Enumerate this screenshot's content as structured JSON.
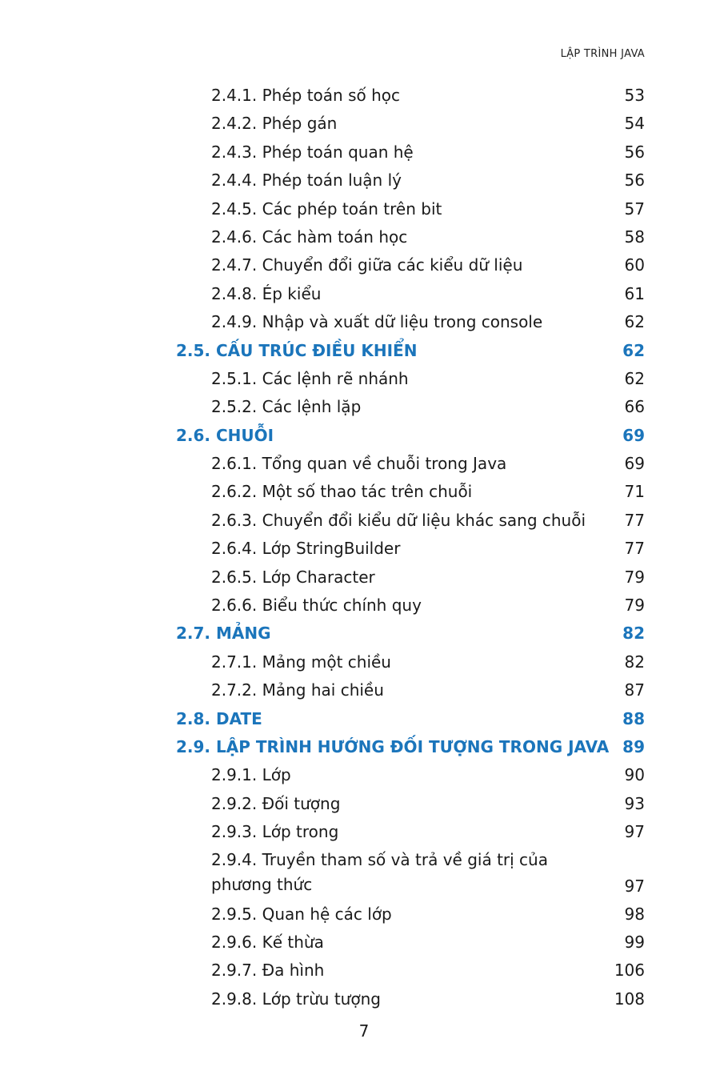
{
  "header": {
    "running_title": "LẬP TRÌNH JAVA"
  },
  "toc": [
    {
      "num": "2.4.1.",
      "title": "Phép toán số học",
      "page": "53"
    },
    {
      "num": "2.4.2.",
      "title": "Phép gán",
      "page": "54"
    },
    {
      "num": "2.4.3.",
      "title": "Phép toán quan hệ",
      "page": "56"
    },
    {
      "num": "2.4.4.",
      "title": "Phép toán luận lý",
      "page": "56"
    },
    {
      "num": "2.4.5.",
      "title": "Các phép toán trên bit",
      "page": "57"
    },
    {
      "num": "2.4.6.",
      "title": "Các hàm toán học",
      "page": "58"
    },
    {
      "num": "2.4.7.",
      "title": "Chuyển đổi giữa các kiểu dữ liệu",
      "page": "60"
    },
    {
      "num": "2.4.8.",
      "title": "Ép kiểu",
      "page": "61"
    },
    {
      "num": "2.4.9.",
      "title": "Nhập và xuất dữ liệu trong console",
      "page": "62"
    },
    {
      "num": "2.5.",
      "title": "CẤU TRÚC ĐIỀU KHIỂN",
      "page": "62"
    },
    {
      "num": "2.5.1.",
      "title": "Các lệnh rẽ nhánh",
      "page": "62"
    },
    {
      "num": "2.5.2.",
      "title": "Các lệnh lặp",
      "page": "66"
    },
    {
      "num": "2.6.",
      "title": "CHUỖI",
      "page": "69"
    },
    {
      "num": "2.6.1.",
      "title": "Tổng quan về chuỗi trong Java",
      "page": "69"
    },
    {
      "num": "2.6.2.",
      "title": "Một số thao tác trên chuỗi",
      "page": "71"
    },
    {
      "num": "2.6.3.",
      "title": "Chuyển đổi kiểu dữ liệu khác sang chuỗi",
      "page": "77"
    },
    {
      "num": "2.6.4.",
      "title": "Lớp StringBuilder",
      "page": "77"
    },
    {
      "num": "2.6.5.",
      "title": "Lớp Character",
      "page": "79"
    },
    {
      "num": "2.6.6.",
      "title": "Biểu thức chính quy",
      "page": "79"
    },
    {
      "num": "2.7.",
      "title": "MẢNG",
      "page": "82"
    },
    {
      "num": "2.7.1.",
      "title": "Mảng một chiều",
      "page": "82"
    },
    {
      "num": "2.7.2.",
      "title": "Mảng hai chiều",
      "page": "87"
    },
    {
      "num": "2.8.",
      "title": "DATE",
      "page": "88"
    },
    {
      "num": "2.9.",
      "title": "LẬP TRÌNH HƯỚNG ĐỐI TƯỢNG TRONG JAVA",
      "page": "89"
    },
    {
      "num": "2.9.1.",
      "title": "Lớp",
      "page": "90"
    },
    {
      "num": "2.9.2.",
      "title": "Đối tượng",
      "page": "93"
    },
    {
      "num": "2.9.3.",
      "title": "Lớp trong",
      "page": "97"
    },
    {
      "num": "2.9.4.",
      "title": "Truyền tham số và trả về giá trị của",
      "title_line2": "phương thức",
      "page": "97"
    },
    {
      "num": "2.9.5.",
      "title": "Quan hệ các lớp",
      "page": "98"
    },
    {
      "num": "2.9.6.",
      "title": "Kế thừa",
      "page": "99"
    },
    {
      "num": "2.9.7.",
      "title": "Đa hình",
      "page": "106"
    },
    {
      "num": "2.9.8.",
      "title": "Lớp trừu tượng",
      "page": "108"
    }
  ],
  "footer": {
    "page_number": "7"
  }
}
